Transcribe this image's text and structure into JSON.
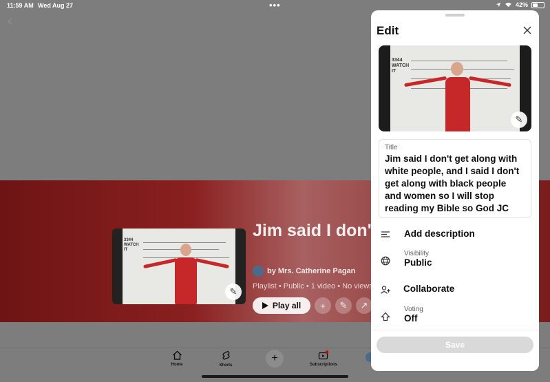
{
  "status_bar": {
    "time": "11:59 AM",
    "date": "Wed Aug 27",
    "dots": "•••",
    "battery": "42%"
  },
  "playlist": {
    "title": "Jim said I don't get along with white people",
    "owner": "by Mrs. Catherine Pagan",
    "meta": "Playlist • Public • 1 video • No views",
    "play_all_label": "Play all"
  },
  "video_overlay_text": "3344 WATCH IT",
  "nav": {
    "home": "Home",
    "shorts": "Shorts",
    "subscriptions": "Subscriptions"
  },
  "edit_sheet": {
    "title": "Edit",
    "title_field_label": "Title",
    "title_field_value": "Jim said I don't get along with white people, and I said I don't get along with black people and women so I will stop reading my Bible so God JC",
    "add_description": "Add description",
    "visibility_label": "Visibility",
    "visibility_value": "Public",
    "collaborate": "Collaborate",
    "voting_label": "Voting",
    "voting_value": "Off",
    "save_label": "Save"
  }
}
